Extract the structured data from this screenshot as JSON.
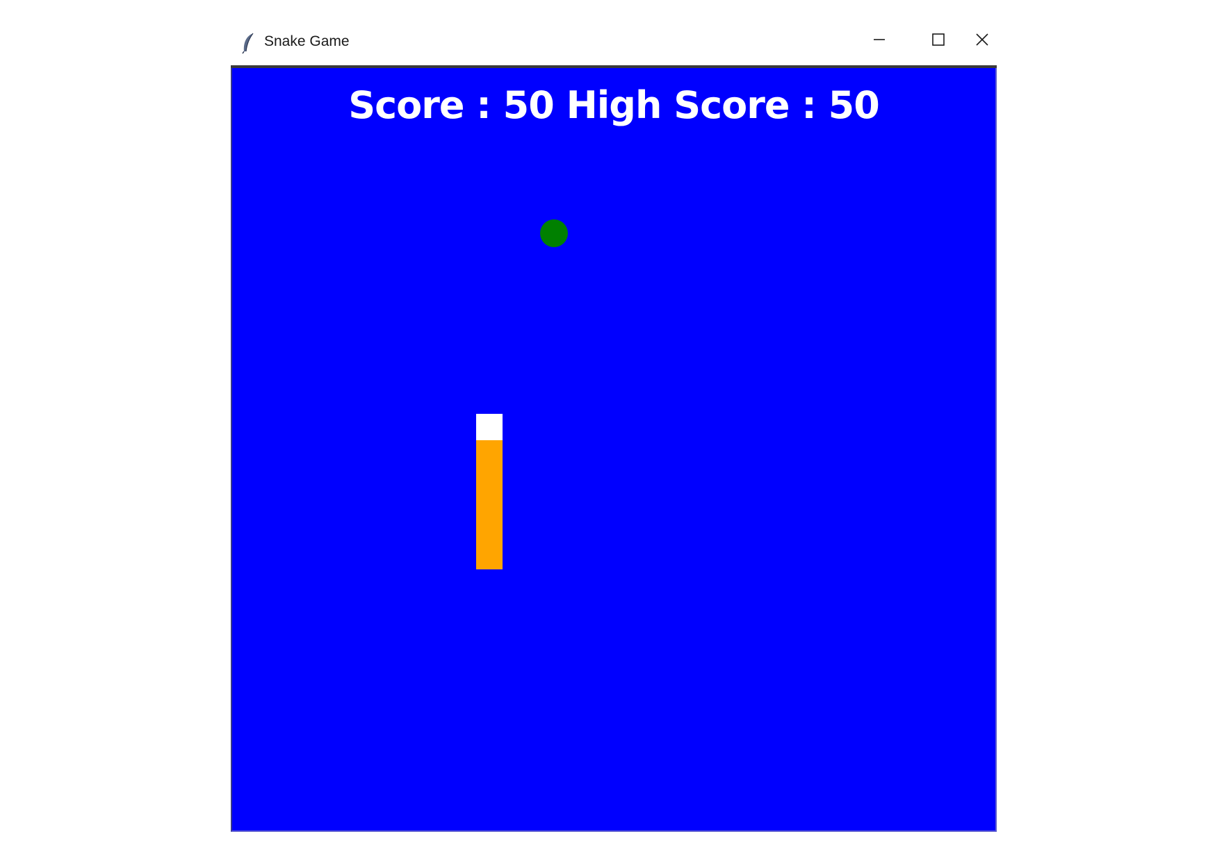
{
  "window": {
    "title": "Snake Game",
    "app_icon": "feather-icon",
    "controls": {
      "minimize_icon": "minimize-icon",
      "maximize_icon": "maximize-icon",
      "close_icon": "close-icon"
    }
  },
  "game": {
    "score_label": "Score : 50 High Score : 50",
    "score": 50,
    "high_score": 50,
    "colors": {
      "background": "#0000ff",
      "text": "#ffffff",
      "food": "#008000",
      "snake_head": "#ffffff",
      "snake_body": "#ffa500"
    }
  }
}
